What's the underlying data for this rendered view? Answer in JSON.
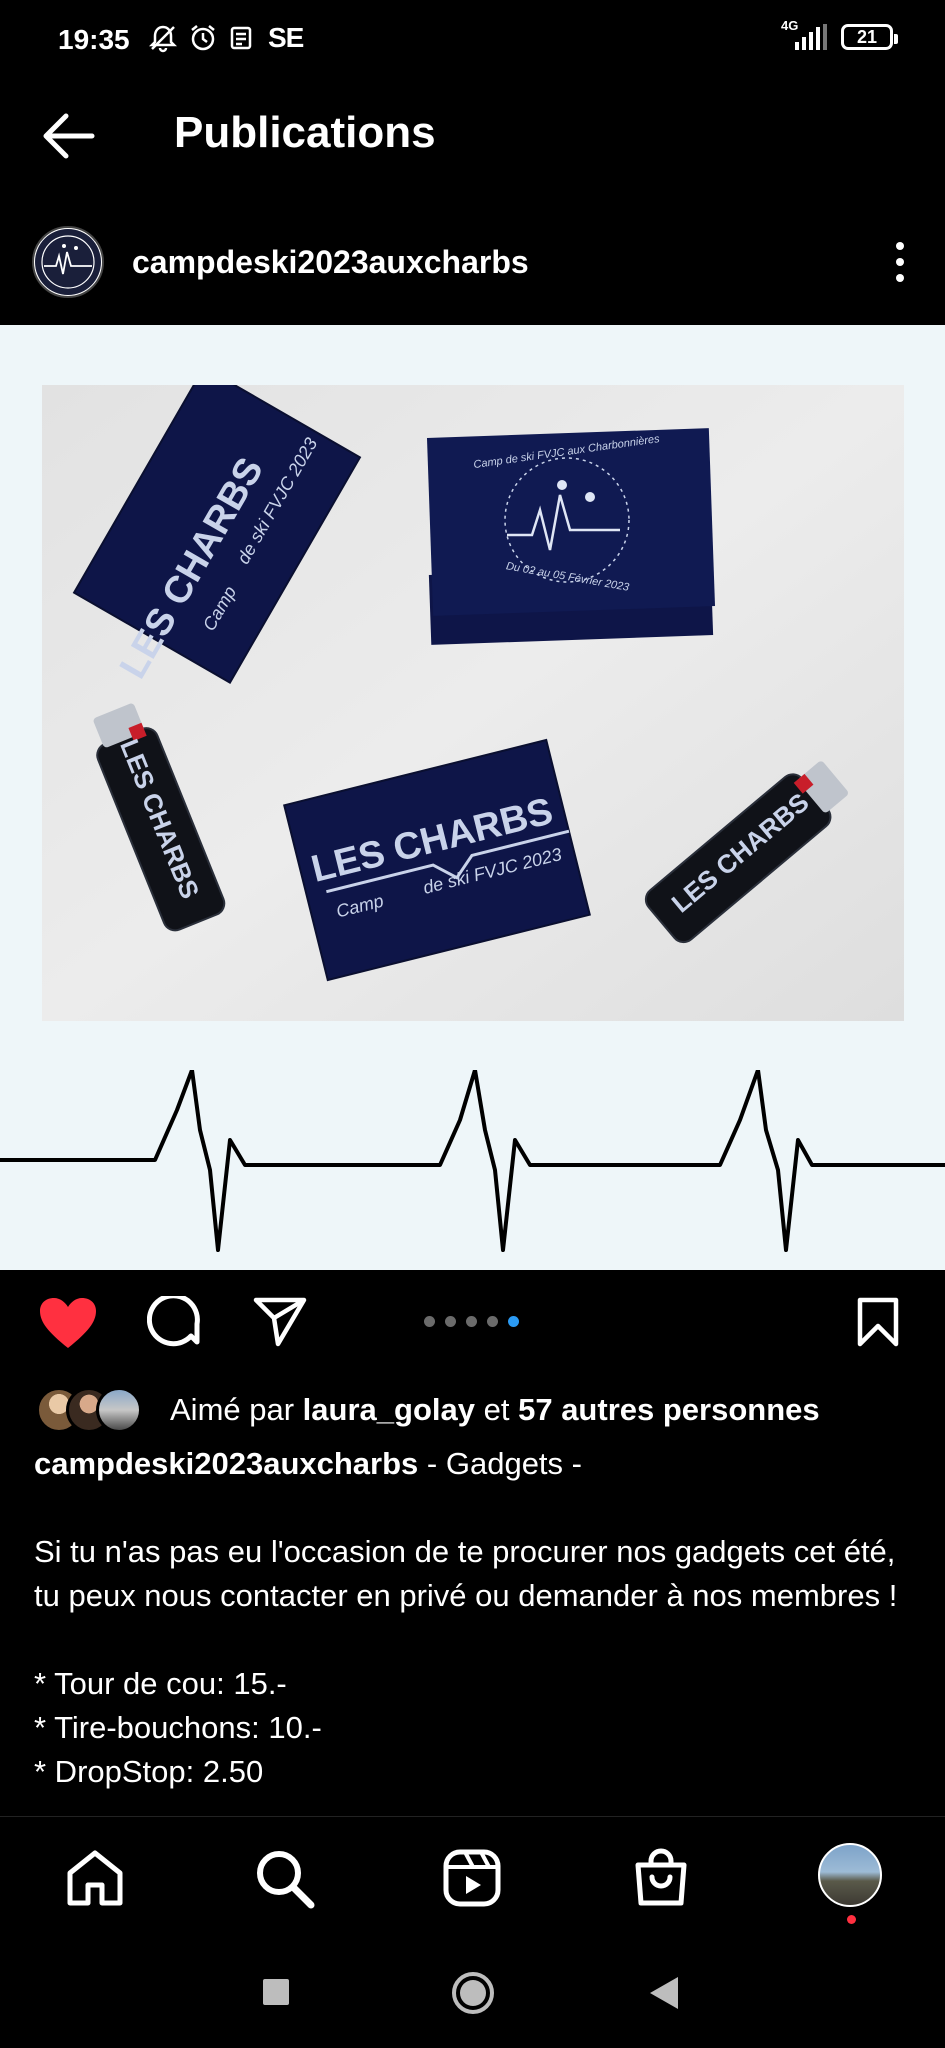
{
  "status": {
    "time": "19:35",
    "carrier_badge": "SE",
    "network": "4G",
    "battery": "21"
  },
  "appbar": {
    "title": "Publications"
  },
  "post": {
    "username": "campdeski2023auxcharbs",
    "photo_texts": {
      "brand": "LES CHARBS",
      "camp": "Camp",
      "event": "de ski FVJC 2023",
      "logo_top": "Camp de ski FVJC aux Charbonnières",
      "logo_bottom": "Du 02 au 05 Février 2023"
    },
    "carousel": {
      "count": 5,
      "active_index": 4
    },
    "likes": {
      "prefix": "Aimé par",
      "user": "laura_golay",
      "conj": "et",
      "others": "57 autres personnes"
    },
    "caption": {
      "title": "- Gadgets -",
      "paragraph": "Si tu n'as pas eu l'occasion de te procurer nos gadgets cet été, tu peux nous contacter en privé ou demander à nos membres !",
      "items": [
        "* Tour de cou: 15.-",
        "* Tire-bouchons: 10.-",
        "* DropStop: 2.50"
      ]
    }
  },
  "icons": {
    "back": "arrow-left-icon",
    "more": "more-vertical-icon",
    "like": "heart-icon",
    "comment": "comment-icon",
    "share": "send-icon",
    "save": "bookmark-icon",
    "home": "home-icon",
    "search": "search-icon",
    "reels": "reels-icon",
    "shop": "shop-icon"
  },
  "colors": {
    "like": "#ff3040",
    "active_dot": "#2b9bf4",
    "background": "#000000",
    "card": "#101a4a"
  }
}
